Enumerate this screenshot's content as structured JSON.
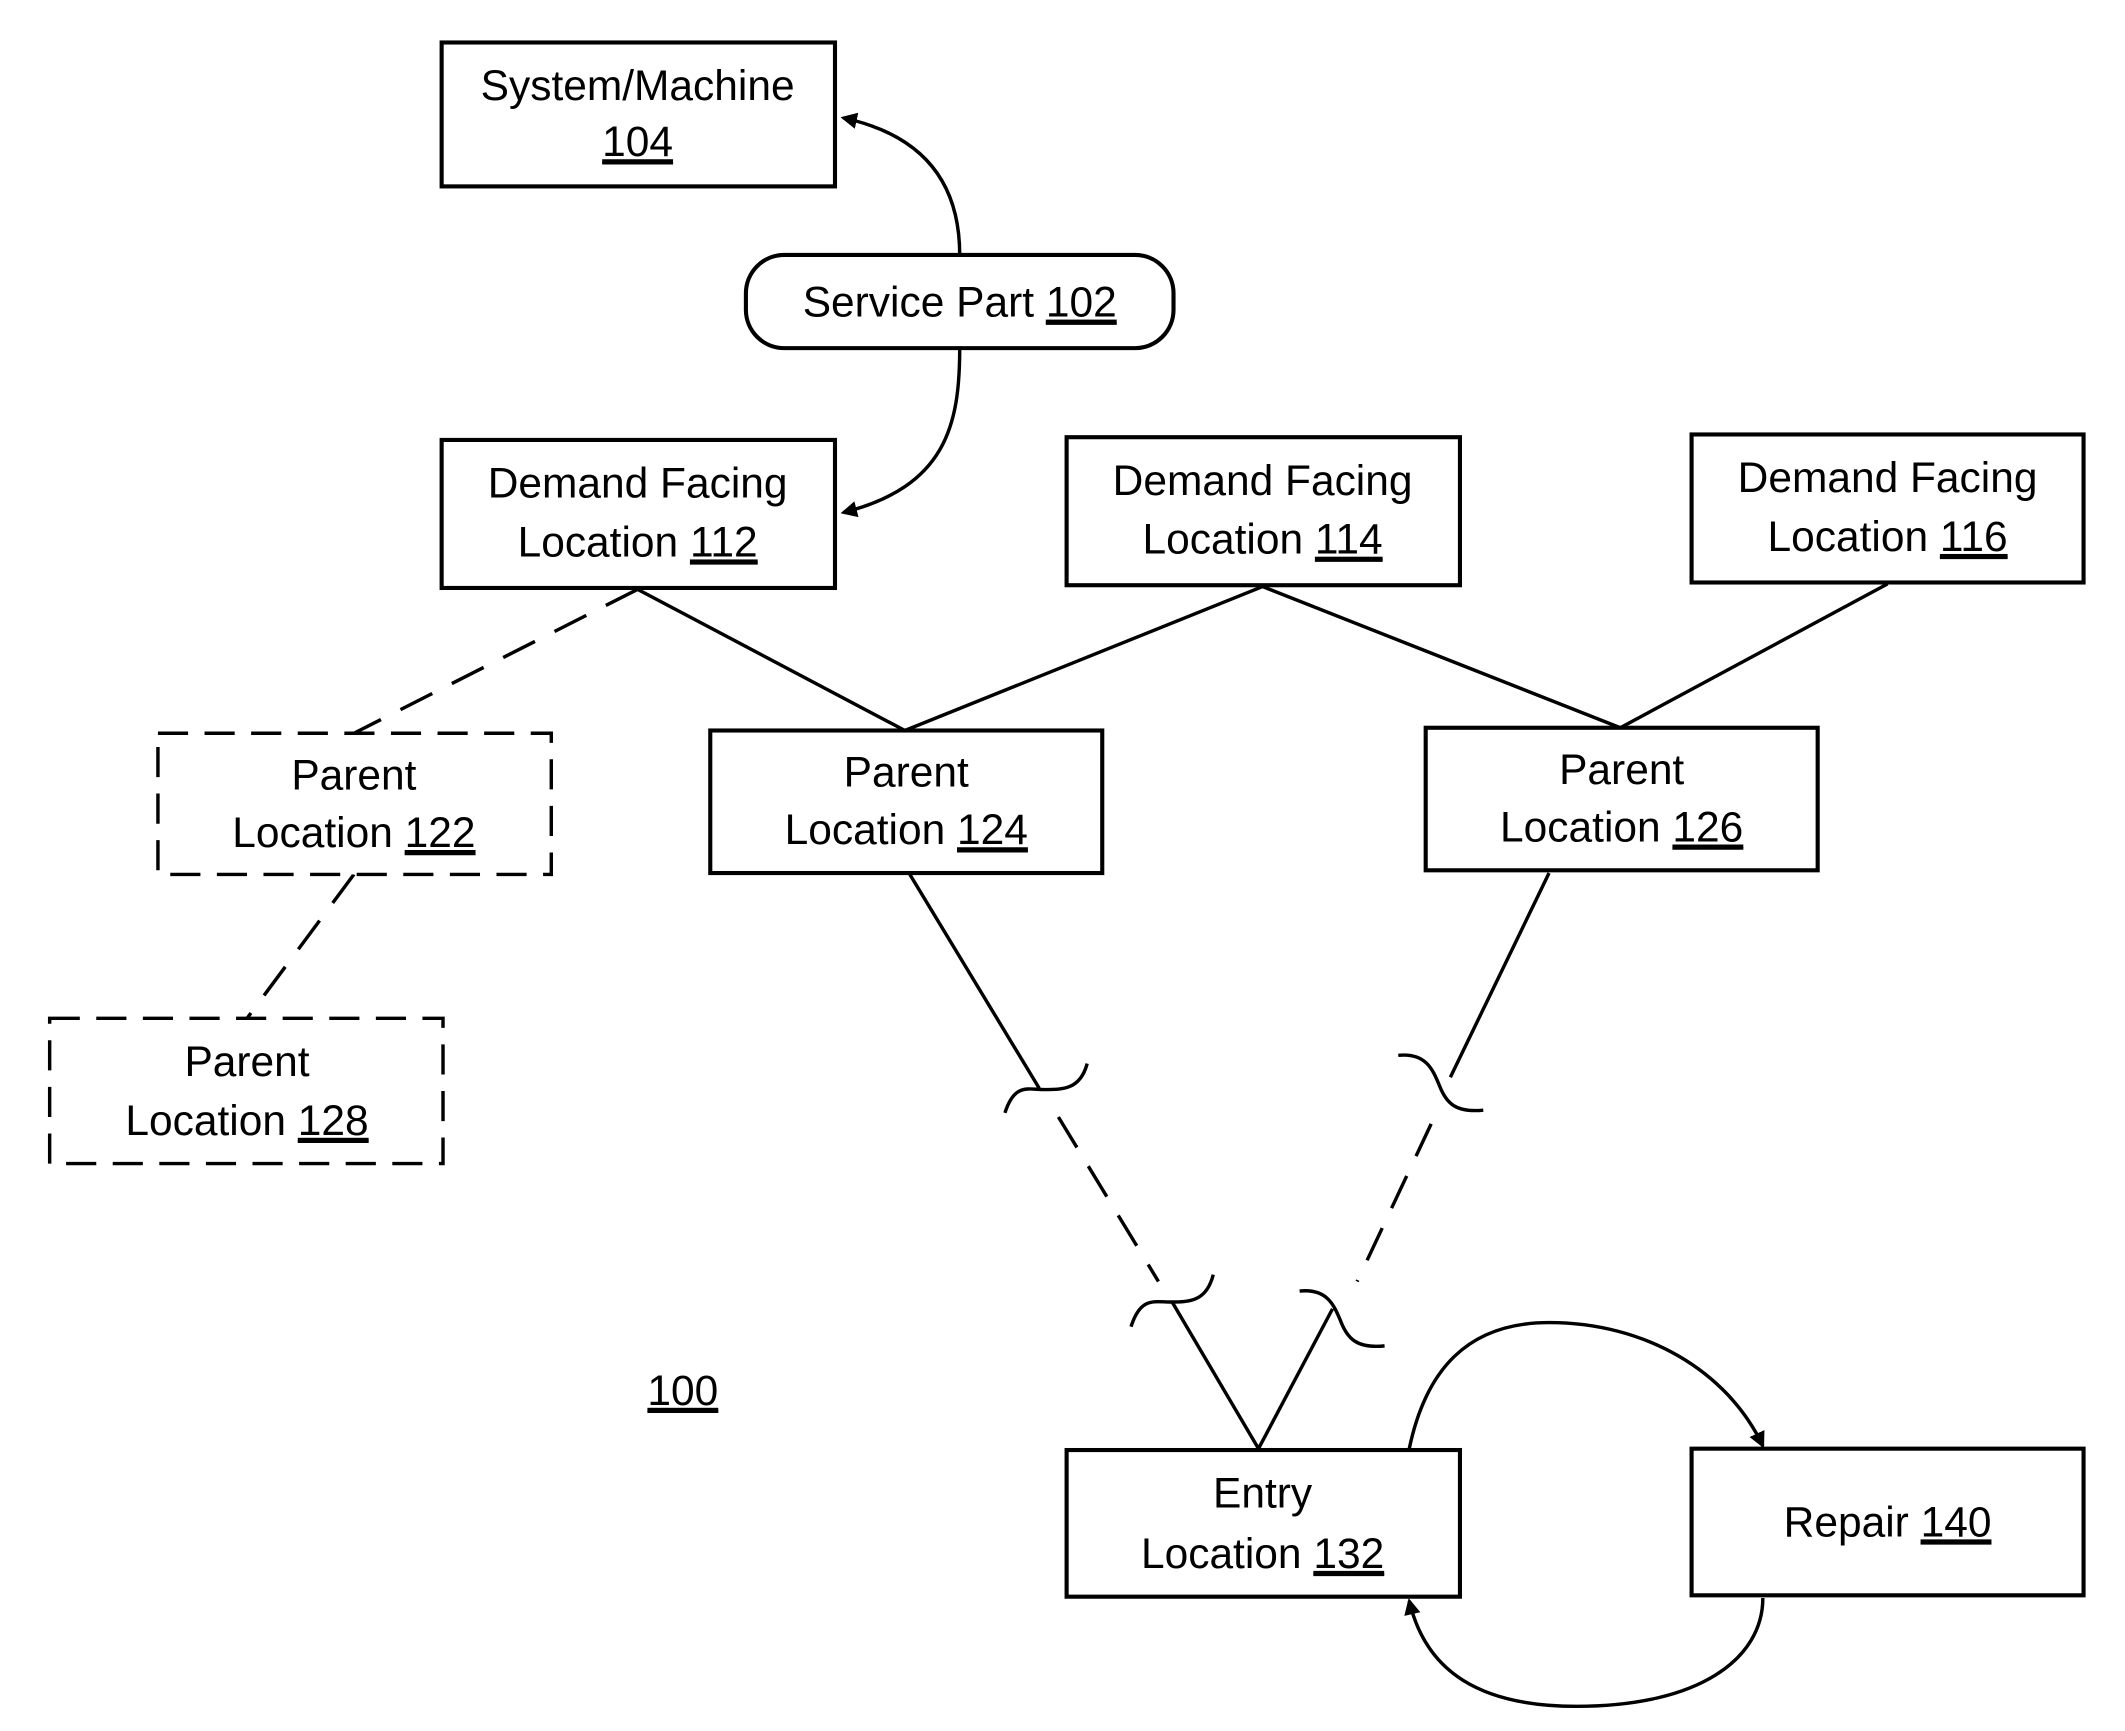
{
  "figure": {
    "reference": "100",
    "nodes": {
      "system_machine": {
        "line1": "System/Machine",
        "line2": "",
        "ref": "104"
      },
      "service_part": {
        "line1": "Service Part ",
        "ref": "102"
      },
      "df112": {
        "line1": "Demand Facing",
        "line2": "Location ",
        "ref": "112"
      },
      "df114": {
        "line1": "Demand Facing",
        "line2": "Location ",
        "ref": "114"
      },
      "df116": {
        "line1": "Demand Facing",
        "line2": "Location ",
        "ref": "116"
      },
      "p122": {
        "line1": "Parent",
        "line2": "Location ",
        "ref": "122"
      },
      "p124": {
        "line1": "Parent",
        "line2": "Location ",
        "ref": "124"
      },
      "p126": {
        "line1": "Parent",
        "line2": "Location ",
        "ref": "126"
      },
      "p128": {
        "line1": "Parent",
        "line2": "Location ",
        "ref": "128"
      },
      "entry132": {
        "line1": "Entry",
        "line2": "Location ",
        "ref": "132"
      },
      "repair140": {
        "line1": "Repair ",
        "ref": "140"
      }
    }
  }
}
